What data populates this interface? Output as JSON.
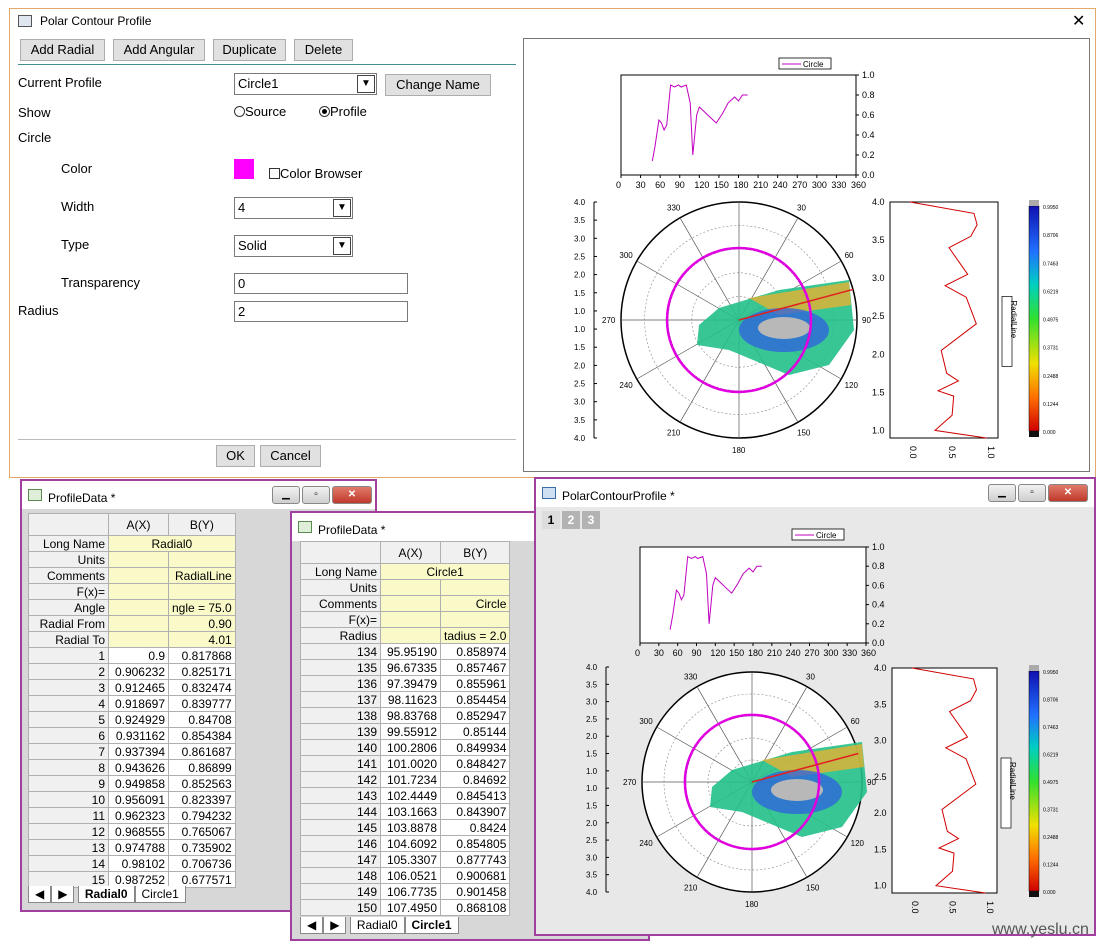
{
  "dialog": {
    "title": "Polar Contour Profile",
    "close": "✕",
    "buttons": {
      "add_radial": "Add Radial",
      "add_angular": "Add Angular",
      "duplicate": "Duplicate",
      "delete": "Delete",
      "change_name": "Change Name",
      "ok": "OK",
      "cancel": "Cancel"
    },
    "current_profile_label": "Current Profile",
    "current_profile_value": "Circle1",
    "show_label": "Show",
    "show_source": "Source",
    "show_profile": "Profile",
    "show_selected": "Profile",
    "section_label": "Circle",
    "color_label": "Color",
    "color_value": "#ff00ff",
    "color_browser": "Color Browser",
    "width_label": "Width",
    "width_value": "4",
    "type_label": "Type",
    "type_value": "Solid",
    "transparency_label": "Transparency",
    "transparency_value": "0",
    "radius_label": "Radius",
    "radius_value": "2"
  },
  "graph": {
    "legend": "Circle",
    "top_y_ticks": [
      "1.0",
      "0.8",
      "0.6",
      "0.4",
      "0.2",
      "0.0"
    ],
    "top_x_ticks": [
      "0",
      "30",
      "60",
      "90",
      "120",
      "150",
      "180",
      "210",
      "240",
      "270",
      "300",
      "330",
      "360"
    ],
    "left_ticks": [
      "4.0",
      "3.5",
      "3.0",
      "2.5",
      "2.0",
      "1.5",
      "1.0",
      "1.0",
      "1.5",
      "2.0",
      "2.5",
      "3.0",
      "3.5",
      "4.0"
    ],
    "angle_labels": [
      "330",
      "30",
      "300",
      "60",
      "270",
      "90",
      "240",
      "120",
      "210",
      "150",
      "180"
    ],
    "right_y_ticks": [
      "4.0",
      "3.5",
      "3.0",
      "2.5",
      "2.0",
      "1.5",
      "1.0"
    ],
    "right_x_ticks": [
      "0.0",
      "0.5",
      "1.0"
    ],
    "right_legend": "RadialLine",
    "colorbar_ticks": [
      "0.9950",
      "0.8706",
      "0.7463",
      "0.6219",
      "0.4975",
      "0.3731",
      "0.2488",
      "0.1244",
      "0.000"
    ]
  },
  "chart_data": [
    {
      "type": "line",
      "title": "",
      "series": [
        {
          "name": "Circle",
          "x": [
            48,
            52,
            58,
            62,
            66,
            70,
            76,
            82,
            88,
            92,
            100,
            106,
            110,
            116,
            120,
            128,
            136,
            146,
            156,
            164,
            174,
            180,
            186,
            194
          ],
          "y": [
            0.14,
            0.28,
            0.55,
            0.52,
            0.45,
            0.5,
            0.9,
            0.88,
            0.9,
            0.88,
            0.9,
            0.72,
            0.2,
            0.6,
            0.68,
            0.63,
            0.58,
            0.52,
            0.62,
            0.72,
            0.78,
            0.74,
            0.8,
            0.8
          ]
        }
      ],
      "xlim": [
        0,
        360
      ],
      "ylim": [
        0,
        1
      ]
    },
    {
      "type": "line",
      "title": "",
      "series": [
        {
          "name": "RadialLine",
          "x": [
            0.0,
            0.82,
            0.86,
            0.78,
            0.5,
            0.74,
            0.45,
            0.72,
            0.85,
            0.4,
            0.47,
            0.62,
            0.36,
            0.56,
            0.54,
            0.32,
            0.98
          ],
          "y": [
            4.0,
            3.85,
            3.7,
            3.55,
            3.4,
            3.05,
            2.9,
            2.75,
            2.4,
            2.05,
            1.75,
            1.65,
            1.52,
            1.45,
            1.2,
            1.0,
            0.9
          ]
        }
      ],
      "xlim": [
        0,
        1
      ],
      "ylim": [
        0.9,
        4.0
      ]
    }
  ],
  "sheet1": {
    "title": "ProfileData *",
    "cols": [
      "A(X)",
      "B(Y)"
    ],
    "meta": [
      [
        "Long Name",
        "Radial0",
        ""
      ],
      [
        "Units",
        "",
        ""
      ],
      [
        "Comments",
        "",
        "RadialLine"
      ],
      [
        "F(x)=",
        "",
        ""
      ],
      [
        "Angle",
        "",
        "ngle = 75.0"
      ],
      [
        "Radial From",
        "",
        "0.90"
      ],
      [
        "Radial To",
        "",
        "4.01"
      ]
    ],
    "rows": [
      [
        "1",
        "0.9",
        "0.817868"
      ],
      [
        "2",
        "0.906232",
        "0.825171"
      ],
      [
        "3",
        "0.912465",
        "0.832474"
      ],
      [
        "4",
        "0.918697",
        "0.839777"
      ],
      [
        "5",
        "0.924929",
        "0.84708"
      ],
      [
        "6",
        "0.931162",
        "0.854384"
      ],
      [
        "7",
        "0.937394",
        "0.861687"
      ],
      [
        "8",
        "0.943626",
        "0.86899"
      ],
      [
        "9",
        "0.949858",
        "0.852563"
      ],
      [
        "10",
        "0.956091",
        "0.823397"
      ],
      [
        "11",
        "0.962323",
        "0.794232"
      ],
      [
        "12",
        "0.968555",
        "0.765067"
      ],
      [
        "13",
        "0.974788",
        "0.735902"
      ],
      [
        "14",
        "0.98102",
        "0.706736"
      ],
      [
        "15",
        "0.987252",
        "0.677571"
      ]
    ],
    "tabs": [
      "Radial0",
      "Circle1"
    ]
  },
  "sheet2": {
    "title": "ProfileData *",
    "cols": [
      "A(X)",
      "B(Y)"
    ],
    "meta": [
      [
        "Long Name",
        "Circle1",
        ""
      ],
      [
        "Units",
        "",
        ""
      ],
      [
        "Comments",
        "",
        "Circle"
      ],
      [
        "F(x)=",
        "",
        ""
      ],
      [
        "Radius",
        "",
        "tadius = 2.0"
      ]
    ],
    "rows": [
      [
        "134",
        "95.95190",
        "0.858974"
      ],
      [
        "135",
        "96.67335",
        "0.857467"
      ],
      [
        "136",
        "97.39479",
        "0.855961"
      ],
      [
        "137",
        "98.11623",
        "0.854454"
      ],
      [
        "138",
        "98.83768",
        "0.852947"
      ],
      [
        "139",
        "99.55912",
        "0.85144"
      ],
      [
        "140",
        "100.2806",
        "0.849934"
      ],
      [
        "141",
        "101.0020",
        "0.848427"
      ],
      [
        "142",
        "101.7234",
        "0.84692"
      ],
      [
        "143",
        "102.4449",
        "0.845413"
      ],
      [
        "144",
        "103.1663",
        "0.843907"
      ],
      [
        "145",
        "103.8878",
        "0.8424"
      ],
      [
        "146",
        "104.6092",
        "0.854805"
      ],
      [
        "147",
        "105.3307",
        "0.877743"
      ],
      [
        "148",
        "106.0521",
        "0.900681"
      ],
      [
        "149",
        "106.7735",
        "0.901458"
      ],
      [
        "150",
        "107.4950",
        "0.868108"
      ]
    ],
    "tabs": [
      "Radial0",
      "Circle1"
    ]
  },
  "graphwin": {
    "title": "PolarContourProfile *",
    "pages": [
      "1",
      "2",
      "3"
    ]
  },
  "watermark": "www.yeslu.cn"
}
